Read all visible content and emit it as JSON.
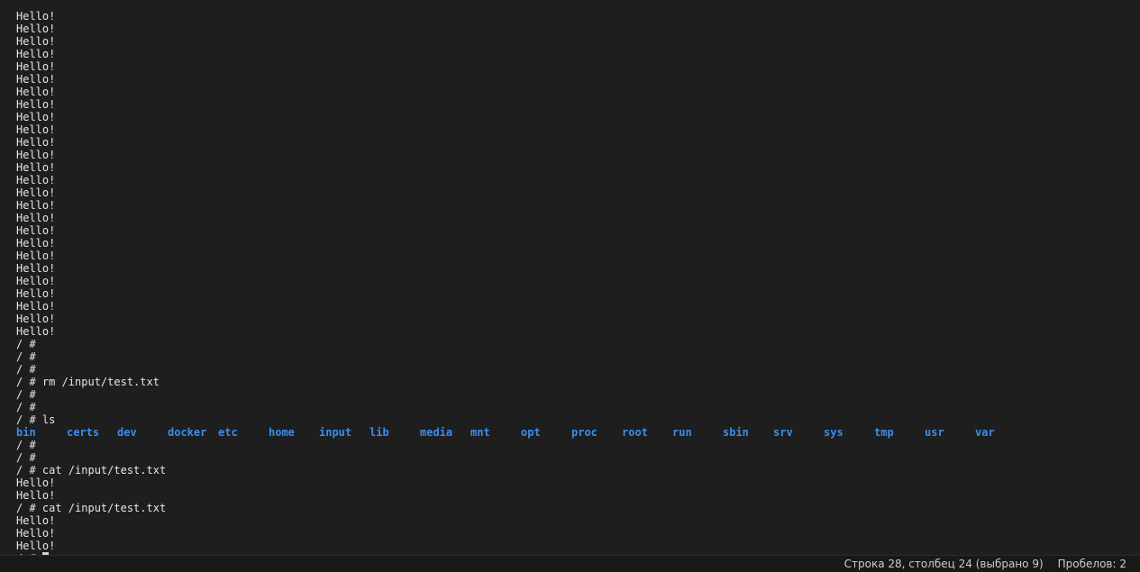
{
  "colors": {
    "background": "#1e1e1e",
    "text": "#e6e6e6",
    "directory": "#3b8eea",
    "cursor": "#d0d0d0",
    "statusbar_background": "#181818",
    "statusbar_text": "#cccccc"
  },
  "terminal": {
    "lines_before_ls": [
      "Hello!",
      "Hello!",
      "Hello!",
      "Hello!",
      "Hello!",
      "Hello!",
      "Hello!",
      "Hello!",
      "Hello!",
      "Hello!",
      "Hello!",
      "Hello!",
      "Hello!",
      "Hello!",
      "Hello!",
      "Hello!",
      "Hello!",
      "Hello!",
      "Hello!",
      "Hello!",
      "Hello!",
      "Hello!",
      "Hello!",
      "Hello!",
      "Hello!",
      "Hello!",
      "/ #",
      "/ #",
      "/ #",
      "/ # rm /input/test.txt",
      "/ #",
      "/ #",
      "/ # ls"
    ],
    "ls_output": [
      "bin",
      "certs",
      "dev",
      "docker",
      "etc",
      "home",
      "input",
      "lib",
      "media",
      "mnt",
      "opt",
      "proc",
      "root",
      "run",
      "sbin",
      "srv",
      "sys",
      "tmp",
      "usr",
      "var"
    ],
    "lines_after_ls": [
      "/ #",
      "/ #",
      "/ # cat /input/test.txt",
      "Hello!",
      "Hello!",
      "/ # cat /input/test.txt",
      "Hello!",
      "Hello!",
      "Hello!"
    ],
    "prompt": "/ # "
  },
  "statusbar": {
    "position": "Строка 28, столбец 24 (выбрано 9)",
    "indentation": "Пробелов: 2"
  }
}
